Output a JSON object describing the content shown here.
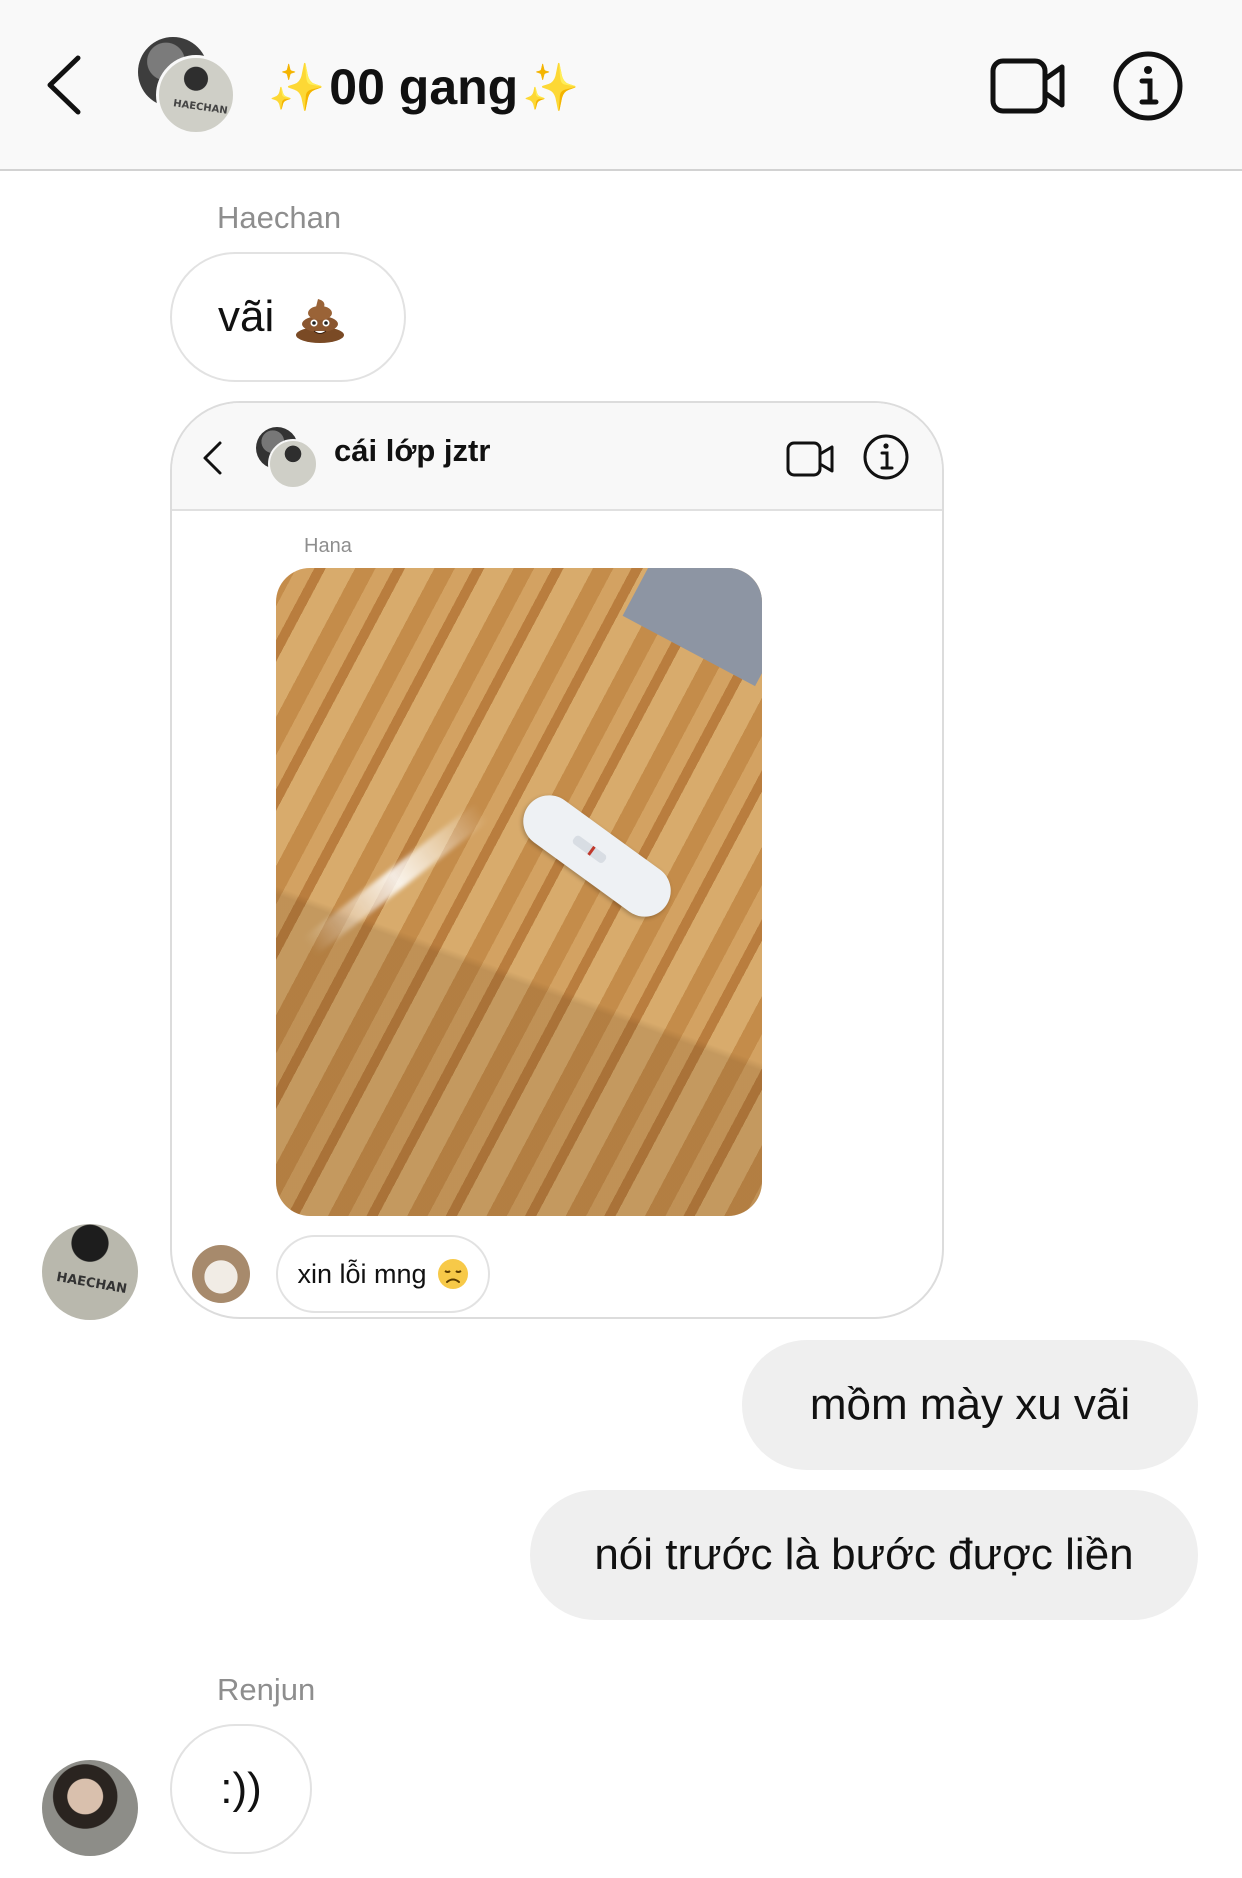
{
  "header": {
    "title": "00 gang",
    "title_prefix_icon": "sparkles",
    "title_suffix_icon": "sparkles",
    "back_icon": "chevron-left",
    "video_icon": "video-camera",
    "info_icon": "info-circle",
    "avatar_text": "HAECHAN"
  },
  "messages": [
    {
      "sender": "Haechan",
      "text": "vãi",
      "emoji": "pile-of-poo",
      "direction": "incoming"
    },
    {
      "type": "shared-screenshot",
      "direction": "incoming"
    },
    {
      "text": "mồm mày xu vãi",
      "direction": "outgoing"
    },
    {
      "text": "nói trước là bước được liền",
      "direction": "outgoing"
    },
    {
      "sender": "Renjun",
      "text": ":))",
      "direction": "incoming"
    }
  ],
  "shared_card": {
    "title": "cái lớp jztr",
    "sender": "Hana",
    "photo_icon": "wooden-table-test-kit-photo",
    "reply_text": "xin lỗi mng",
    "reply_emoji": "disappointed-face"
  },
  "colors": {
    "header_bg": "#f9f9f9",
    "outgoing_bubble": "#efefef",
    "incoming_border": "#e2e2e2",
    "sender_name": "#8e8e8e",
    "sparkle": "#e6b32f"
  }
}
